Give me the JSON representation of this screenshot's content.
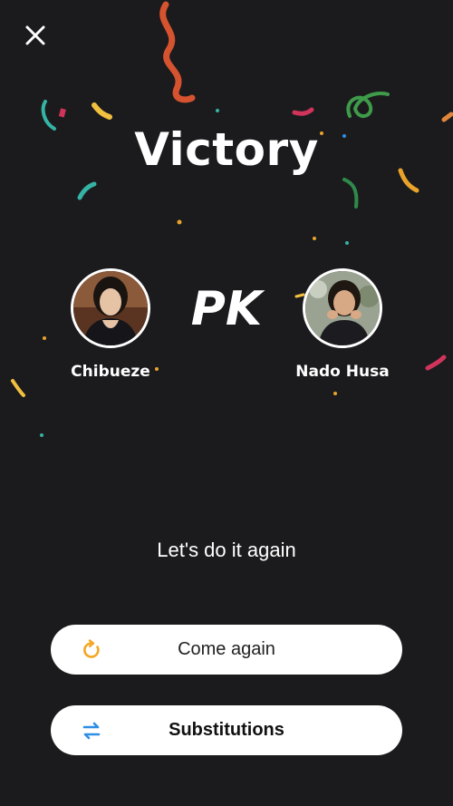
{
  "header": {
    "close_icon": "close-icon"
  },
  "result": {
    "title": "Victory",
    "versus_label": "PK"
  },
  "players": [
    {
      "name": "Chibueze",
      "avatar": "avatar-photo"
    },
    {
      "name": "Nado Husa",
      "avatar": "avatar-photo"
    }
  ],
  "prompt": {
    "text": "Let's do it again"
  },
  "actions": {
    "come_again": {
      "label": "Come again",
      "icon": "refresh-icon",
      "icon_color": "#f5a623"
    },
    "substitutions": {
      "label": "Substitutions",
      "icon": "swap-icon",
      "icon_color": "#2f8fe6"
    }
  },
  "colors": {
    "background": "#1b1b1d",
    "text": "#ffffff",
    "button_bg": "#ffffff"
  }
}
